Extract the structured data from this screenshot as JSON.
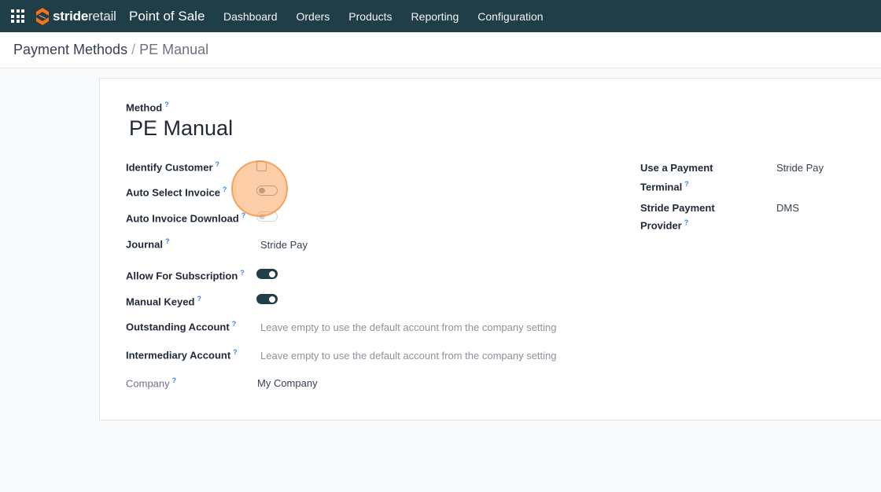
{
  "navbar": {
    "brand_bold": "stride",
    "brand_light": "retail",
    "app_title": "Point of Sale",
    "menu": [
      "Dashboard",
      "Orders",
      "Products",
      "Reporting",
      "Configuration"
    ]
  },
  "breadcrumb": {
    "parent": "Payment Methods",
    "separator": "/",
    "current": "PE Manual"
  },
  "form": {
    "method_label": "Method",
    "method_value": "PE Manual",
    "help_mark": "?",
    "identify_customer": {
      "label": "Identify Customer",
      "checked": false
    },
    "auto_select_invoice": {
      "label": "Auto Select Invoice",
      "enabled": false
    },
    "auto_invoice_download": {
      "label": "Auto Invoice Download",
      "enabled": false
    },
    "journal": {
      "label": "Journal",
      "value": "Stride Pay"
    },
    "allow_for_subscription": {
      "label": "Allow For Subscription",
      "enabled": true
    },
    "manual_keyed": {
      "label": "Manual Keyed",
      "enabled": true
    },
    "outstanding_account": {
      "label": "Outstanding Account",
      "placeholder": "Leave empty to use the default account from the company setting"
    },
    "intermediary_account": {
      "label": "Intermediary Account",
      "placeholder": "Leave empty to use the default account from the company setting"
    },
    "company": {
      "label": "Company",
      "value": "My Company"
    },
    "payment_terminal": {
      "label_line1": "Use a Payment",
      "label_line2": "Terminal",
      "value": "Stride Pay"
    },
    "payment_provider": {
      "label_line1": "Stride Payment",
      "label_line2": "Provider",
      "value": "DMS"
    }
  },
  "colors": {
    "navbar": "#1f3e47",
    "toggle_on": "#1f3e47",
    "click_highlight": "#fb923c"
  }
}
